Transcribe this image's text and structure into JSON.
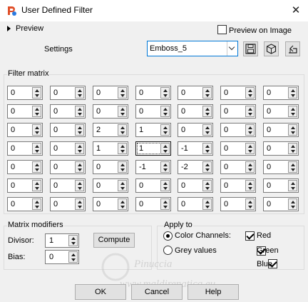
{
  "window": {
    "title": "User Defined Filter",
    "close_glyph": "✕"
  },
  "preview": {
    "label": "Preview",
    "on_image_label": "Preview on Image",
    "on_image_checked": false
  },
  "settings": {
    "label": "Settings",
    "preset_value": "Emboss_5"
  },
  "toolbar": {
    "icons": [
      "save-icon",
      "cube-icon",
      "reset-icon"
    ]
  },
  "filter_matrix": {
    "title": "Filter matrix",
    "rows": [
      [
        "0",
        "0",
        "0",
        "0",
        "0",
        "0",
        "0"
      ],
      [
        "0",
        "0",
        "0",
        "0",
        "0",
        "0",
        "0"
      ],
      [
        "0",
        "0",
        "2",
        "1",
        "0",
        "0",
        "0"
      ],
      [
        "0",
        "0",
        "1",
        "1",
        "-1",
        "0",
        "0"
      ],
      [
        "0",
        "0",
        "0",
        "-1",
        "-2",
        "0",
        "0"
      ],
      [
        "0",
        "0",
        "0",
        "0",
        "0",
        "0",
        "0"
      ],
      [
        "0",
        "0",
        "0",
        "0",
        "0",
        "0",
        "0"
      ]
    ]
  },
  "matrix_modifiers": {
    "title": "Matrix modifiers",
    "divisor_label": "Divisor:",
    "divisor_value": "1",
    "bias_label": "Bias:",
    "bias_value": "0",
    "compute_label": "Compute"
  },
  "apply_to": {
    "title": "Apply to",
    "color_channels_label": "Color Channels:",
    "grey_values_label": "Grey values",
    "selected": "color",
    "red_label": "Red",
    "green_label": "Green",
    "blue_label": "Blue",
    "red_checked": true,
    "green_checked": true,
    "blue_checked": true
  },
  "buttons": {
    "ok": "OK",
    "cancel": "Cancel",
    "help": "Help"
  },
  "watermark": {
    "line1": "Pinuccia",
    "line2": "www.maldirenatica.eu"
  }
}
